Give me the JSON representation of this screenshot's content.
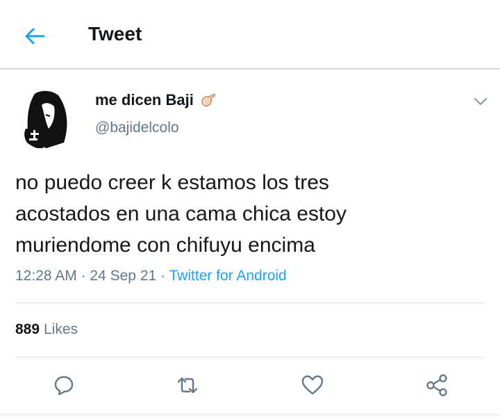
{
  "header": {
    "title": "Tweet"
  },
  "user": {
    "display_name": "me dicen Baji",
    "handle": "@bajidelcolo"
  },
  "tweet": {
    "text_lines": [
      "no puedo creer k estamos los tres",
      "acostados en una cama chica estoy",
      "muriendome con chifuyu encima"
    ],
    "time": "12:28 AM",
    "date": "24 Sep 21",
    "separator": "·",
    "source": "Twitter for Android"
  },
  "stats": {
    "likes_count": "889",
    "likes_label": "Likes"
  },
  "icons": {
    "back": "arrow-left-icon",
    "caret": "chevron-down-icon",
    "reply": "reply-icon",
    "retweet": "retweet-icon",
    "like": "heart-icon",
    "share": "share-icon",
    "name_emoji": "hand-emoji-icon"
  },
  "colors": {
    "accent": "#1da1f2",
    "text": "#14171a",
    "muted": "#657786",
    "icon": "#657786"
  }
}
